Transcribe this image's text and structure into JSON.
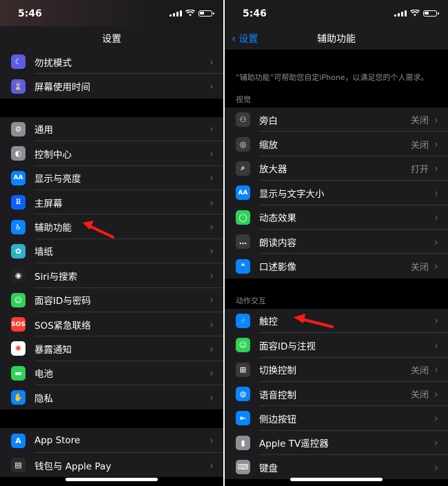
{
  "left": {
    "time": "5:46",
    "title": "设置",
    "groups": [
      [
        {
          "label": "勿扰模式",
          "icon": "moon-icon",
          "color": "#5e5ce6",
          "glyph": "☾"
        },
        {
          "label": "屏幕使用时间",
          "icon": "hourglass-icon",
          "color": "#5e5ce6",
          "glyph": "⌛"
        }
      ],
      [
        {
          "label": "通用",
          "icon": "gear-icon",
          "color": "#8e8e93",
          "glyph": "⚙"
        },
        {
          "label": "控制中心",
          "icon": "switches-icon",
          "color": "#8e8e93",
          "glyph": "◐"
        },
        {
          "label": "显示与亮度",
          "icon": "text-size-icon",
          "color": "#0a84ff",
          "glyph": "AA"
        },
        {
          "label": "主屏幕",
          "icon": "home-grid-icon",
          "color": "#0a60ff",
          "glyph": "⠿"
        },
        {
          "label": "辅助功能",
          "icon": "accessibility-icon",
          "color": "#0a84ff",
          "glyph": "♿"
        },
        {
          "label": "墙纸",
          "icon": "wallpaper-flower-icon",
          "color": "#30b0c7",
          "glyph": "✿"
        },
        {
          "label": "Siri与搜索",
          "icon": "siri-icon",
          "color": "#222",
          "glyph": "◉"
        },
        {
          "label": "面容ID与密码",
          "icon": "face-id-icon",
          "color": "#30d158",
          "glyph": "☺"
        },
        {
          "label": "SOS紧急联络",
          "icon": "sos-icon",
          "color": "#ff3b30",
          "glyph": "SOS"
        },
        {
          "label": "暴露通知",
          "icon": "exposure-icon",
          "color": "#ffffff",
          "glyph": "✺"
        },
        {
          "label": "电池",
          "icon": "battery-icon",
          "color": "#30d158",
          "glyph": "▬"
        },
        {
          "label": "隐私",
          "icon": "hand-icon",
          "color": "#0a84ff",
          "glyph": "✋"
        }
      ],
      [
        {
          "label": "App Store",
          "icon": "app-store-icon",
          "color": "#0a84ff",
          "glyph": "A"
        },
        {
          "label": "钱包与 Apple Pay",
          "icon": "wallet-icon",
          "color": "#2c2c2e",
          "glyph": "▤"
        }
      ]
    ]
  },
  "right": {
    "time": "5:46",
    "back": "设置",
    "title": "辅助功能",
    "description": "“辅助功能”可帮助您自定iPhone，以满足您的个人需求。",
    "sections": [
      {
        "header": "视觉",
        "rows": [
          {
            "label": "旁白",
            "value": "关闭",
            "icon": "voiceover-icon",
            "color": "#3a3a3c",
            "glyph": "⚇"
          },
          {
            "label": "缩放",
            "value": "关闭",
            "icon": "zoom-icon",
            "color": "#3a3a3c",
            "glyph": "◎"
          },
          {
            "label": "放大器",
            "value": "打开",
            "icon": "magnifier-icon",
            "color": "#3a3a3c",
            "glyph": "⌕"
          },
          {
            "label": "显示与文字大小",
            "value": "",
            "icon": "text-size-icon",
            "color": "#0a84ff",
            "glyph": "AA"
          },
          {
            "label": "动态效果",
            "value": "",
            "icon": "motion-icon",
            "color": "#30d158",
            "glyph": "◯"
          },
          {
            "label": "朗读内容",
            "value": "",
            "icon": "speech-bubble-icon",
            "color": "#3a3a3c",
            "glyph": "…"
          },
          {
            "label": "口述影像",
            "value": "关闭",
            "icon": "audio-description-icon",
            "color": "#0a84ff",
            "glyph": "❝"
          }
        ]
      },
      {
        "header": "动作交互",
        "rows": [
          {
            "label": "触控",
            "value": "",
            "icon": "touch-hand-icon",
            "color": "#0a84ff",
            "glyph": "☝"
          },
          {
            "label": "面容ID与注视",
            "value": "",
            "icon": "face-id-icon",
            "color": "#30d158",
            "glyph": "☺"
          },
          {
            "label": "切换控制",
            "value": "关闭",
            "icon": "switch-control-icon",
            "color": "#3a3a3c",
            "glyph": "⊞"
          },
          {
            "label": "语音控制",
            "value": "关闭",
            "icon": "voice-control-icon",
            "color": "#0a84ff",
            "glyph": "◍"
          },
          {
            "label": "侧边按钮",
            "value": "",
            "icon": "side-button-icon",
            "color": "#0a84ff",
            "glyph": "⇤"
          },
          {
            "label": "Apple TV遥控器",
            "value": "",
            "icon": "remote-icon",
            "color": "#8e8e93",
            "glyph": "▮"
          },
          {
            "label": "键盘",
            "value": "",
            "icon": "keyboard-icon",
            "color": "#8e8e93",
            "glyph": "⌨"
          }
        ]
      }
    ]
  },
  "chevron": "›"
}
